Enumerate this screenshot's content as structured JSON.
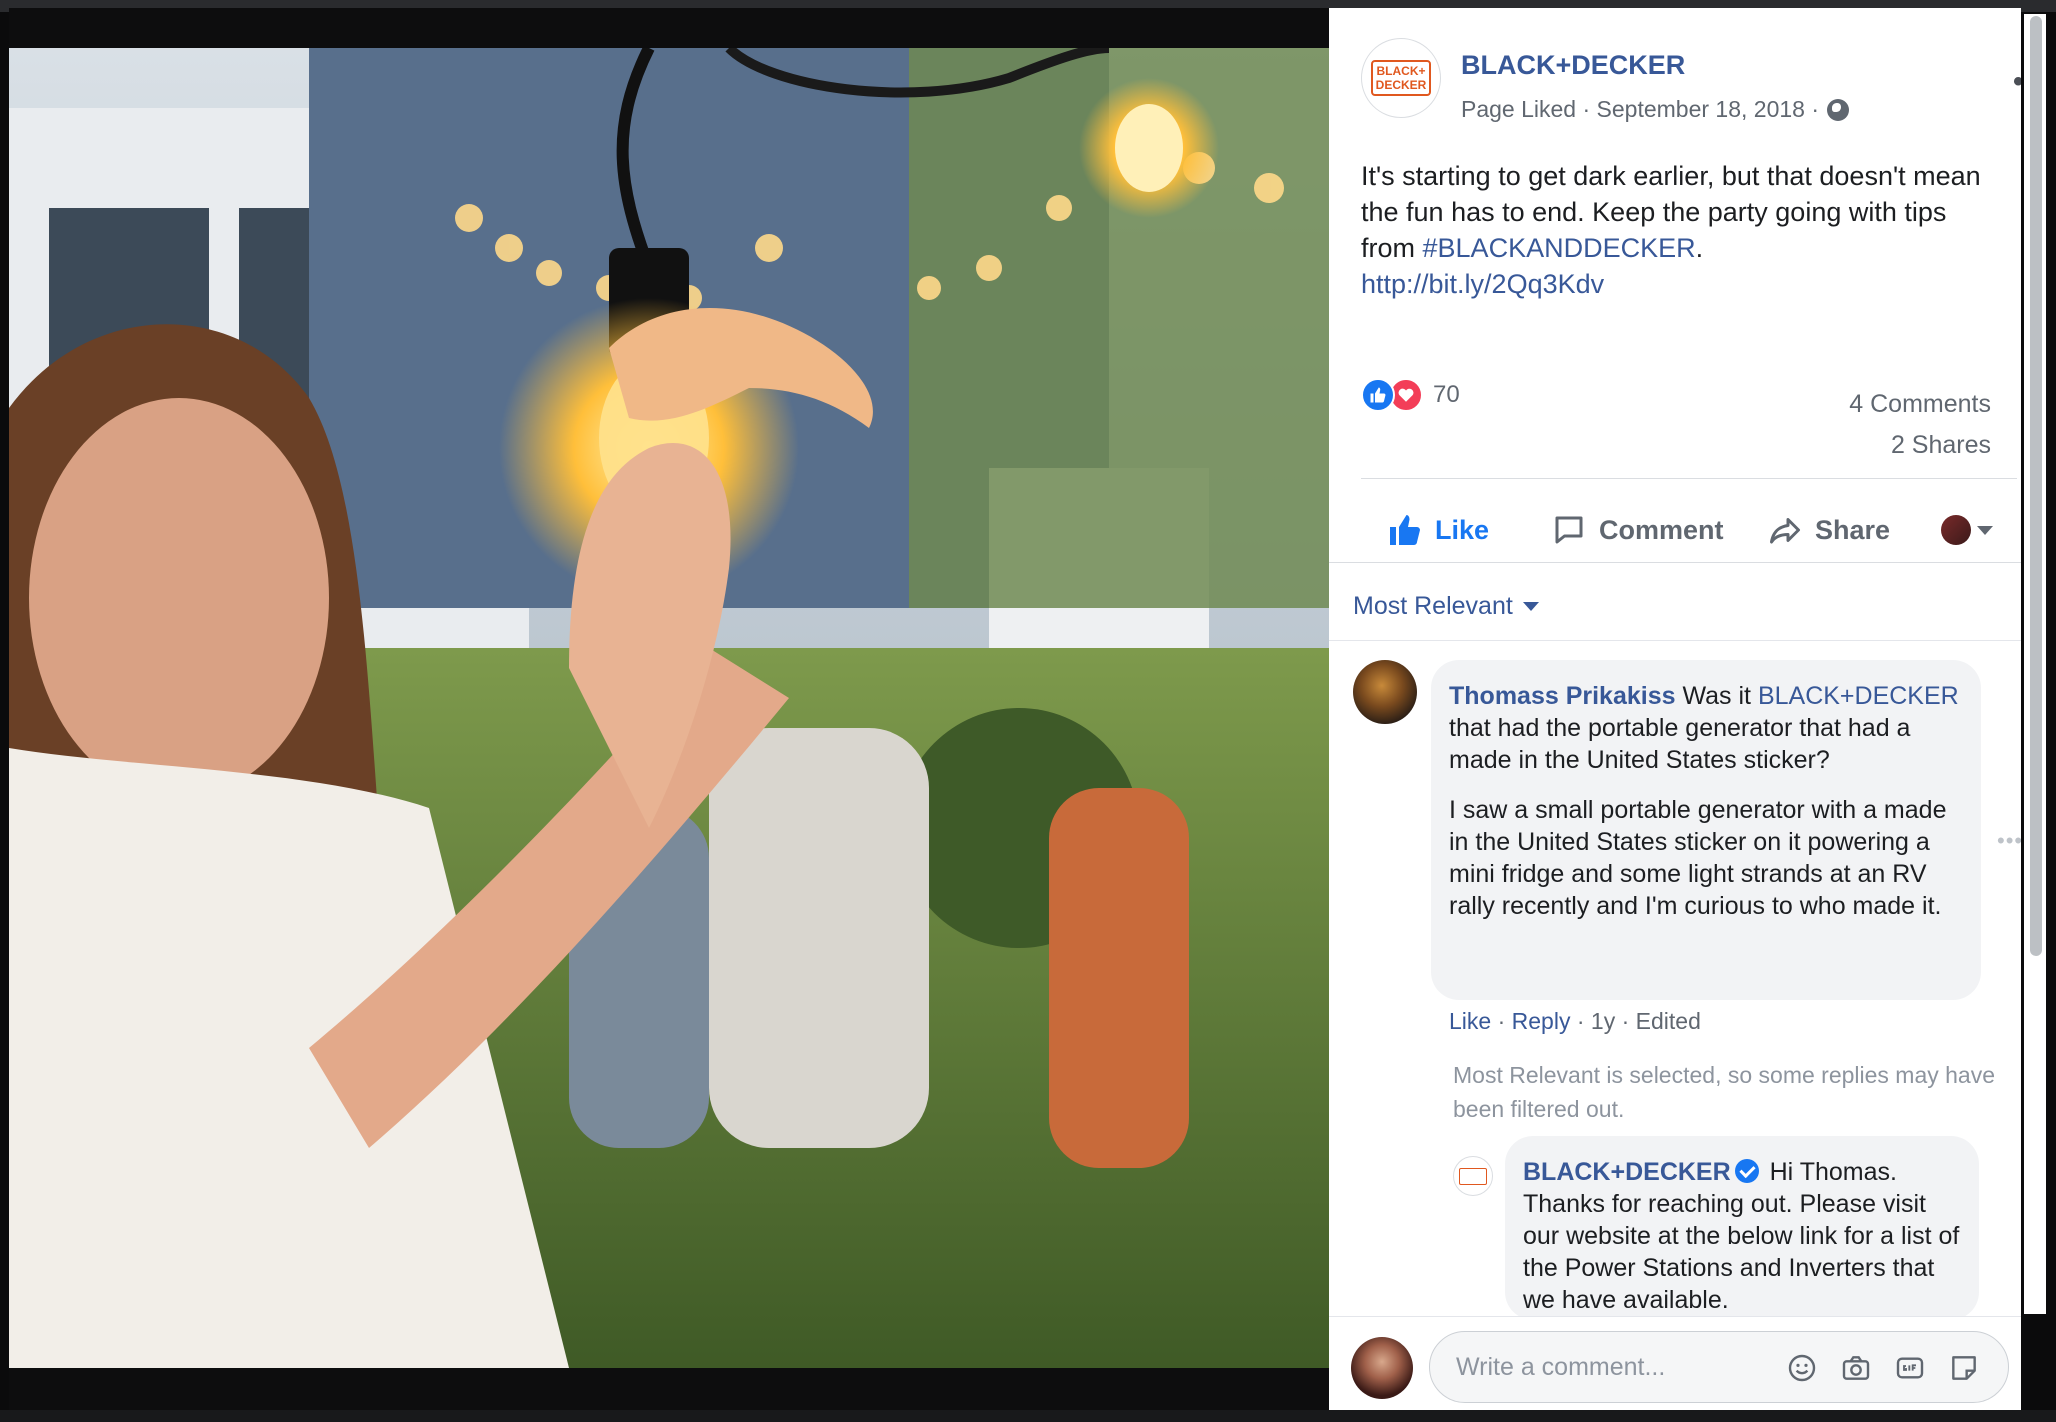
{
  "post": {
    "page_name": "BLACK+DECKER",
    "logo_text_top": "BLACK+",
    "logo_text_bottom": "DECKER",
    "meta": "Page Liked · September 18, 2018 ·",
    "text_main": "It's starting to get dark earlier, but that doesn't mean the fun has to end. Keep the party going with tips from ",
    "hashtag": "#BLACKANDDECKER",
    "text_after_tag": ".",
    "link": "http://bit.ly/2Qq3Kdv",
    "reaction_count": "70",
    "comments_count": "4 Comments",
    "shares_count": "2 Shares"
  },
  "actions": {
    "like": "Like",
    "comment": "Comment",
    "share": "Share"
  },
  "sort": {
    "label": "Most Relevant"
  },
  "comment": {
    "author": "Thomass Prikakiss",
    "text_1a": " Was it ",
    "mention": "BLACK+DECKER",
    "text_1b": " that had the portable generator that had a made in the United States sticker?",
    "text_2": "I saw a small portable generator with a made in the United States sticker on it powering a mini fridge and some light strands at an RV rally recently and I'm curious to who made it.",
    "like": "Like",
    "reply": "Reply",
    "age": "1y",
    "edited": "Edited"
  },
  "filter_note": "Most Relevant is selected, so some replies may have been filtered out.",
  "reply": {
    "author": "BLACK+DECKER",
    "text": " Hi Thomas. Thanks for reaching out. Please visit our website at the below link for a list of the Power Stations and Inverters that we have available."
  },
  "composer": {
    "placeholder": "Write a comment..."
  },
  "colors": {
    "link_blue": "#385898",
    "like_blue": "#1877f2",
    "love_red": "#f33e58",
    "brand_orange": "#e0581f"
  }
}
